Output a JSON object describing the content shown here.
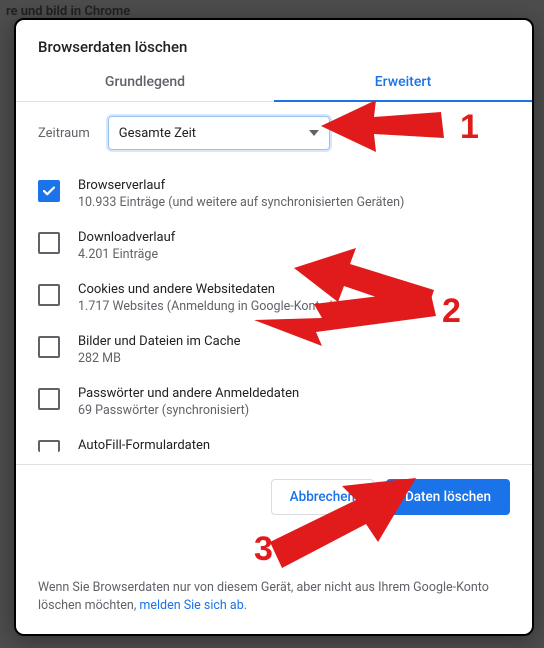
{
  "backdrop_snippet": "re und  bild in Chrome",
  "dialog": {
    "title": "Browserdaten löschen",
    "tabs": {
      "basic": "Grundlegend",
      "advanced": "Erweitert",
      "active": "advanced"
    },
    "time_range": {
      "label": "Zeitraum",
      "selected": "Gesamte Zeit"
    },
    "items": [
      {
        "checked": true,
        "label": "Browserverlauf",
        "sub": "10.933 Einträge (und weitere auf synchronisierten Geräten)"
      },
      {
        "checked": false,
        "label": "Downloadverlauf",
        "sub": "4.201 Einträge"
      },
      {
        "checked": false,
        "label": "Cookies und andere Websitedaten",
        "sub": "1.717 Websites (Anmeldung in Google-Konto bleibt erhalten)"
      },
      {
        "checked": false,
        "label": "Bilder und Dateien im Cache",
        "sub": "282 MB"
      },
      {
        "checked": false,
        "label": "Passwörter und andere Anmeldedaten",
        "sub": "69 Passwörter (synchronisiert)"
      },
      {
        "checked": false,
        "label": "AutoFill-Formulardaten",
        "sub": ""
      }
    ],
    "buttons": {
      "cancel": "Abbrechen",
      "confirm": "Daten löschen"
    },
    "note_prefix": "Wenn Sie Browserdaten nur von diesem Gerät, aber nicht aus Ihrem Google-Konto löschen möchten, ",
    "note_link": "melden Sie sich ab",
    "note_suffix": "."
  },
  "annotations": {
    "n1": "1",
    "n2": "2",
    "n3": "3"
  }
}
